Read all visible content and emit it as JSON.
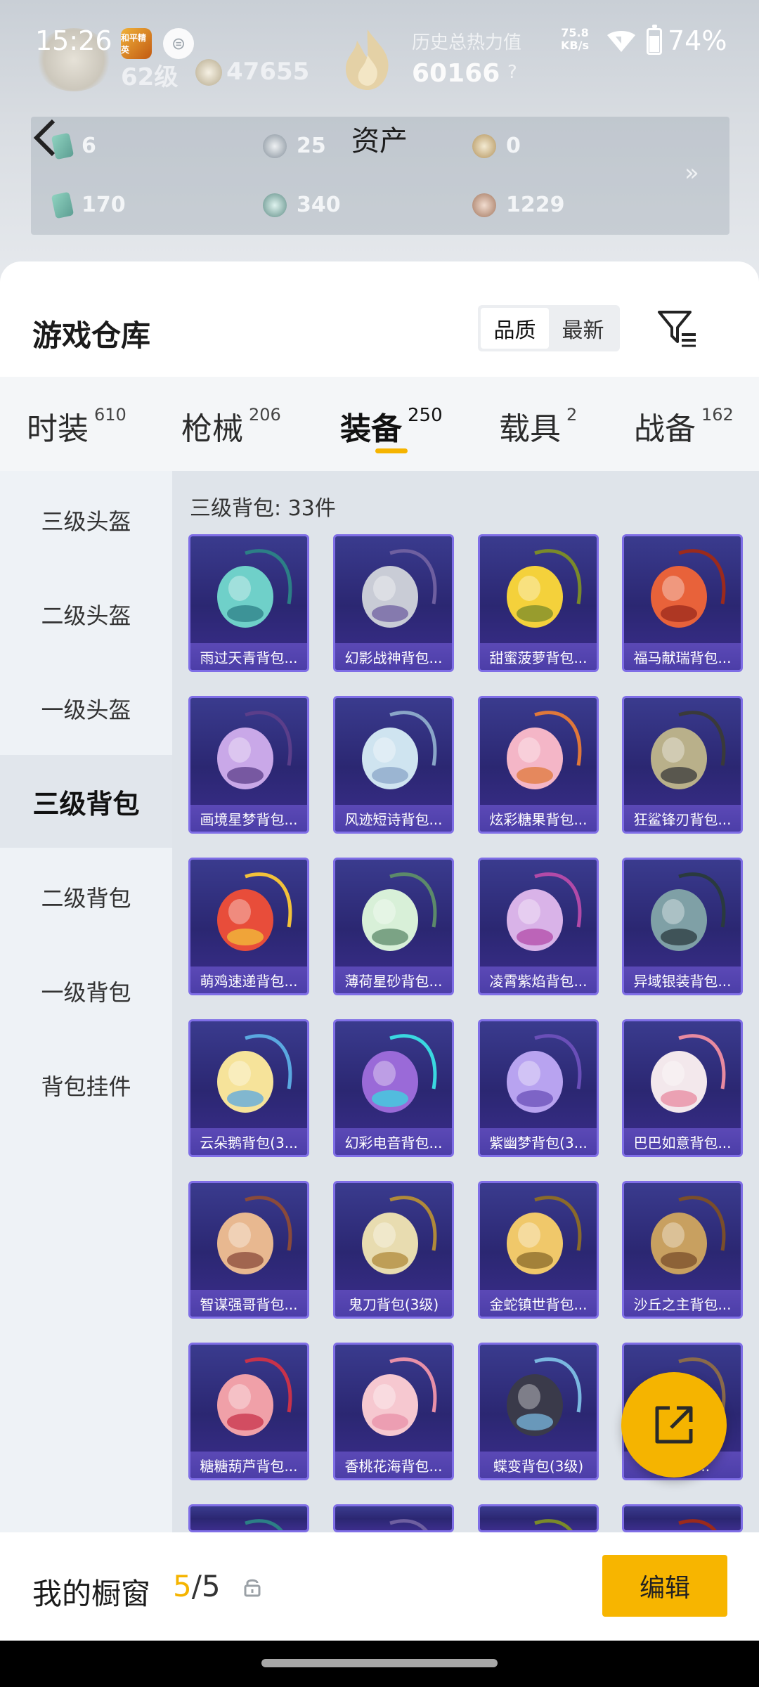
{
  "status_bar": {
    "time": "15:26",
    "net_speed": "75.8",
    "net_unit": "KB/s",
    "battery": "74%",
    "app_icon_label": "和平精英"
  },
  "profile": {
    "level": "62级",
    "trophies": "47655",
    "heat_label": "历史总热力值",
    "heat_value": "60166",
    "help": "?"
  },
  "assets": {
    "title": "资产",
    "items": [
      {
        "icon": "card-icon",
        "value": "6"
      },
      {
        "icon": "silver-coin-icon",
        "value": "25"
      },
      {
        "icon": "gold-coin-icon",
        "value": "0"
      },
      {
        "icon": "ticket-icon",
        "value": "170"
      },
      {
        "icon": "teal-orb-icon",
        "value": "340"
      },
      {
        "icon": "bronze-coin-icon",
        "value": "1229"
      }
    ],
    "more": "»"
  },
  "warehouse": {
    "title": "游戏仓库",
    "sort": [
      "品质",
      "最新"
    ]
  },
  "tabs": [
    {
      "label": "时装",
      "count": "610"
    },
    {
      "label": "枪械",
      "count": "206"
    },
    {
      "label": "装备",
      "count": "250"
    },
    {
      "label": "载具",
      "count": "2"
    },
    {
      "label": "战备",
      "count": "162"
    }
  ],
  "categories": [
    "三级头盔",
    "二级头盔",
    "一级头盔",
    "三级背包",
    "二级背包",
    "一级背包",
    "背包挂件"
  ],
  "active_category": "三级背包",
  "grid": {
    "header": "三级背包: 33件",
    "items": [
      "雨过天青背包...",
      "幻影战神背包...",
      "甜蜜菠萝背包...",
      "福马献瑞背包...",
      "画境星梦背包...",
      "风迹短诗背包...",
      "炫彩糖果背包...",
      "狂鲨锋刃背包...",
      "萌鸡速递背包...",
      "薄荷星砂背包...",
      "凌霄紫焰背包...",
      "异域银装背包...",
      "云朵鹅背包(3...",
      "幻彩电音背包...",
      "紫幽梦背包(3...",
      "巴巴如意背包...",
      "智谋强哥背包...",
      "鬼刀背包(3级)",
      "金蛇镇世背包...",
      "沙丘之主背包...",
      "糖糖葫芦背包...",
      "香桃花海背包...",
      "蝶变背包(3级)",
      "...背包..."
    ]
  },
  "showcase": {
    "label": "我的橱窗",
    "used": "5",
    "separator": "/",
    "total": "5",
    "edit": "编辑"
  },
  "colors": {
    "accent": "#f5b400",
    "card_bg": "#2b2772",
    "card_border": "#7f6ee6"
  }
}
